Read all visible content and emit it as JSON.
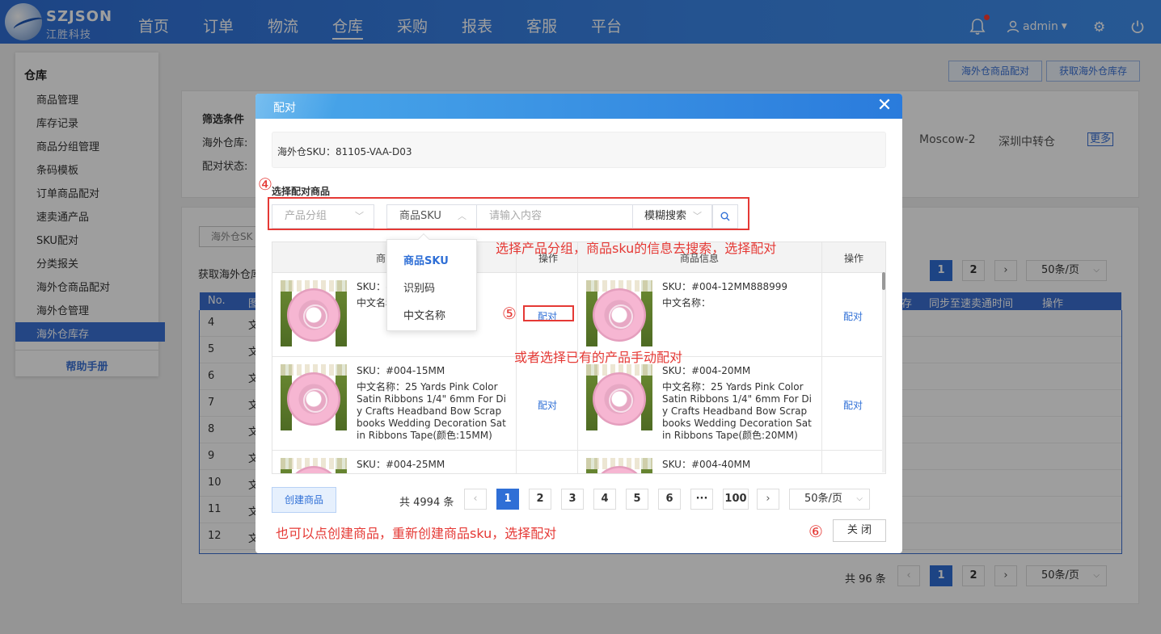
{
  "brand": {
    "name": "SZJSON",
    "sub": "江胜科技"
  },
  "nav": {
    "items": [
      "首页",
      "订单",
      "物流",
      "仓库",
      "采购",
      "报表",
      "客服",
      "平台"
    ],
    "active": "仓库"
  },
  "user": {
    "name": "admin"
  },
  "sidebar": {
    "title": "仓库",
    "items": [
      "商品管理",
      "库存记录",
      "商品分组管理",
      "条码模板",
      "订单商品配对",
      "速卖通产品",
      "SKU配对",
      "分类报关",
      "海外仓商品配对",
      "海外仓管理",
      "海外仓库存"
    ],
    "active": "海外仓库存",
    "help": "帮助手册"
  },
  "background": {
    "top_buttons": [
      "海外仓商品配对",
      "获取海外仓库存"
    ],
    "filter_title": "筛选条件",
    "filter_warehouse_label": "海外仓库:",
    "filter_status_label": "配对状态:",
    "warehouse_options": [
      "Moscow-2",
      "深圳中转仓"
    ],
    "more_label": "更多",
    "tab_partial": "海外仓SK",
    "info_partial": "获取海外仓库",
    "table_headers_right": [
      "存",
      "同步至速卖通时间",
      "操作"
    ],
    "table_header_no": "No.",
    "table_header_partial": "图",
    "rows": [
      {
        "no": "4",
        "cell": "文"
      },
      {
        "no": "5",
        "cell": "文"
      },
      {
        "no": "6",
        "cell": "文"
      },
      {
        "no": "7",
        "cell": "文"
      },
      {
        "no": "8",
        "cell": "文"
      },
      {
        "no": "9",
        "cell": "文"
      },
      {
        "no": "10",
        "cell": "文"
      },
      {
        "no": "11",
        "cell": "文"
      },
      {
        "no": "12",
        "cell": "文"
      }
    ],
    "pager_top": {
      "pages": [
        "1",
        "2"
      ],
      "size": "50条/页"
    },
    "pager_bottom": {
      "total": "共 96 条",
      "pages": [
        "1",
        "2"
      ],
      "size": "50条/页"
    }
  },
  "modal": {
    "title": "配对",
    "sku_line": "海外仓SKU：81105-VAA-D03",
    "section_label": "选择配对商品",
    "group_placeholder": "产品分组",
    "field_select": "商品SKU",
    "search_placeholder": "请输入内容",
    "match_mode": "模糊搜索",
    "dropdown": {
      "options": [
        "商品SKU",
        "识别码",
        "中文名称"
      ],
      "selected": "商品SKU"
    },
    "grid": {
      "headers": [
        "商品信息",
        "操作",
        "商品信息",
        "操作"
      ],
      "header_partial": "商品",
      "rows": [
        {
          "left": {
            "sku": "SKU：#",
            "name": "中文名称："
          },
          "right": {
            "sku": "SKU：#004-12MM888999",
            "name": "中文名称："
          },
          "op": "配对"
        },
        {
          "left": {
            "sku": "SKU：#004-15MM",
            "name": "中文名称：25 Yards Pink Color Satin Ribbons 1/4\" 6mm For Diy Crafts Headband Bow Scrapbooks Wedding Decoration Satin Ribbons Tape(颜色:15MM)"
          },
          "right": {
            "sku": "SKU：#004-20MM",
            "name": "中文名称：25 Yards Pink Color Satin Ribbons 1/4\" 6mm For Diy Crafts Headband Bow Scrapbooks Wedding Decoration Satin Ribbons Tape(颜色:20MM)"
          },
          "op": "配对"
        },
        {
          "left": {
            "sku": "SKU：#004-25MM",
            "name": ""
          },
          "right": {
            "sku": "SKU：#004-40MM",
            "name": ""
          },
          "op": ""
        }
      ]
    },
    "create_button": "创建商品",
    "total": "共 4994 条",
    "pages": [
      "1",
      "2",
      "3",
      "4",
      "5",
      "6",
      "···",
      "100"
    ],
    "active_page": "1",
    "page_size": "50条/页",
    "close_button": "关 闭"
  },
  "annotations": {
    "step4": "④",
    "step5": "⑤",
    "step6": "⑥",
    "note_search": "选择产品分组，商品sku的信息去搜索，选择配对",
    "note_manual": "或者选择已有的产品手动配对",
    "note_create": "也可以点创建商品，重新创建商品sku，选择配对"
  },
  "colors": {
    "accent": "#2f6fd6",
    "annotation": "#e53935"
  }
}
